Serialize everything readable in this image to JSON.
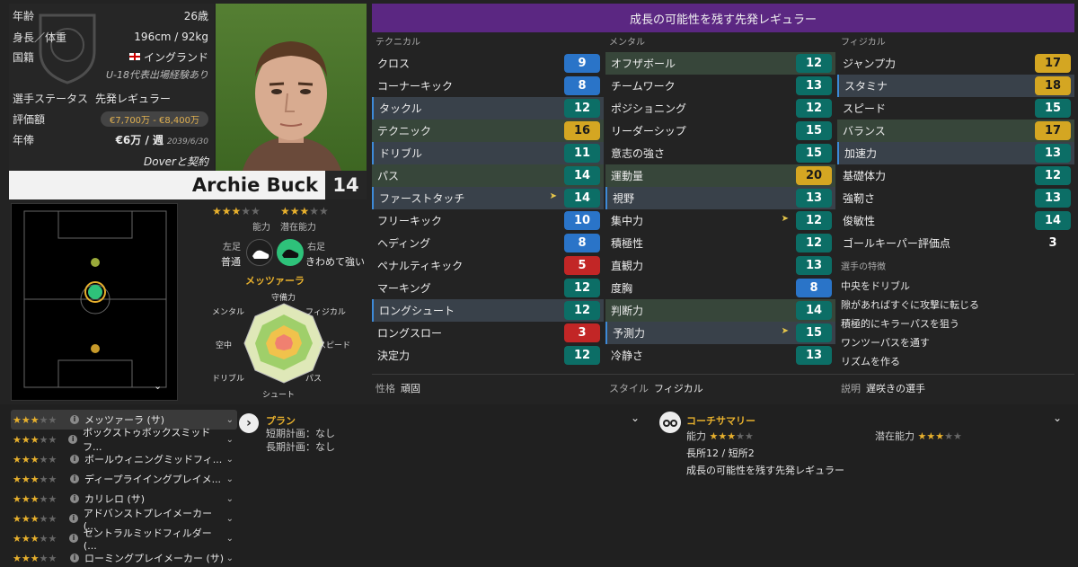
{
  "header": {
    "title": "成長の可能性を残す先発レギュラー"
  },
  "info": {
    "age_label": "年齢",
    "age": "26歳",
    "hw_label": "身長／体重",
    "hw": "196cm / 92kg",
    "nat_label": "国籍",
    "nat": "イングランド",
    "nat_note": "U-18代表出場経験あり",
    "status_label": "選手ステータス",
    "status": "先発レギュラー",
    "value_label": "評価額",
    "value": "€7,700万 - €8,400万",
    "wage_label": "年俸",
    "wage": "€6万 / 週",
    "wage_until": "2039/6/30",
    "contract": "Doverと契約"
  },
  "player": {
    "name": "Archie Buck",
    "number": "14"
  },
  "rating": {
    "ability_label": "能力",
    "potential_label": "潜在能力"
  },
  "feet": {
    "left_label": "左足",
    "left_value": "普通",
    "right_label": "右足",
    "right_value": "きわめて強い"
  },
  "role_name": "メッツァーラ",
  "radar": {
    "labels": [
      "守備力",
      "フィジカル",
      "スピード",
      "パス",
      "シュート",
      "ドリブル",
      "空中",
      "メンタル"
    ]
  },
  "attributes": {
    "technical": {
      "label": "テクニカル",
      "items": [
        {
          "name": "クロス",
          "value": "9",
          "color": "blue"
        },
        {
          "name": "コーナーキック",
          "value": "8",
          "color": "blue"
        },
        {
          "name": "タックル",
          "value": "12",
          "color": "teal",
          "hl": "hl"
        },
        {
          "name": "テクニック",
          "value": "16",
          "color": "gold",
          "hl": "hlg"
        },
        {
          "name": "ドリブル",
          "value": "11",
          "color": "teal",
          "hl": "hl"
        },
        {
          "name": "パス",
          "value": "14",
          "color": "teal",
          "hl": "hlg"
        },
        {
          "name": "ファーストタッチ",
          "value": "14",
          "color": "teal",
          "hl": "hl",
          "arrow": true
        },
        {
          "name": "フリーキック",
          "value": "10",
          "color": "blue"
        },
        {
          "name": "ヘディング",
          "value": "8",
          "color": "blue"
        },
        {
          "name": "ペナルティキック",
          "value": "5",
          "color": "red"
        },
        {
          "name": "マーキング",
          "value": "12",
          "color": "teal"
        },
        {
          "name": "ロングシュート",
          "value": "12",
          "color": "teal",
          "hl": "hl"
        },
        {
          "name": "ロングスロー",
          "value": "3",
          "color": "red"
        },
        {
          "name": "決定力",
          "value": "12",
          "color": "teal"
        }
      ]
    },
    "mental": {
      "label": "メンタル",
      "items": [
        {
          "name": "オフザボール",
          "value": "12",
          "color": "teal",
          "hl": "hlg"
        },
        {
          "name": "チームワーク",
          "value": "13",
          "color": "teal"
        },
        {
          "name": "ポジショニング",
          "value": "12",
          "color": "teal"
        },
        {
          "name": "リーダーシップ",
          "value": "15",
          "color": "teal"
        },
        {
          "name": "意志の強さ",
          "value": "15",
          "color": "teal"
        },
        {
          "name": "運動量",
          "value": "20",
          "color": "gold",
          "hl": "hlg"
        },
        {
          "name": "視野",
          "value": "13",
          "color": "teal",
          "hl": "hl"
        },
        {
          "name": "集中力",
          "value": "12",
          "color": "teal",
          "arrow": true
        },
        {
          "name": "積極性",
          "value": "12",
          "color": "teal"
        },
        {
          "name": "直観力",
          "value": "13",
          "color": "teal"
        },
        {
          "name": "度胸",
          "value": "8",
          "color": "blue"
        },
        {
          "name": "判断力",
          "value": "14",
          "color": "teal",
          "hl": "hlg"
        },
        {
          "name": "予測力",
          "value": "15",
          "color": "teal",
          "hl": "hl",
          "arrow": true
        },
        {
          "name": "冷静さ",
          "value": "13",
          "color": "teal"
        }
      ]
    },
    "physical": {
      "label": "フィジカル",
      "items": [
        {
          "name": "ジャンプ力",
          "value": "17",
          "color": "gold"
        },
        {
          "name": "スタミナ",
          "value": "18",
          "color": "gold",
          "hl": "hl"
        },
        {
          "name": "スピード",
          "value": "15",
          "color": "teal"
        },
        {
          "name": "バランス",
          "value": "17",
          "color": "gold",
          "hl": "hlg"
        },
        {
          "name": "加速力",
          "value": "13",
          "color": "teal",
          "hl": "hl"
        },
        {
          "name": "基礎体力",
          "value": "12",
          "color": "teal"
        },
        {
          "name": "強靭さ",
          "value": "13",
          "color": "teal"
        },
        {
          "name": "俊敏性",
          "value": "14",
          "color": "teal"
        },
        {
          "name": "ゴールキーパー評価点",
          "value": "3",
          "color": "plain"
        }
      ]
    },
    "traits_label": "選手の特徴",
    "traits": [
      "中央をドリブル",
      "隙があればすぐに攻撃に転じる",
      "積極的にキラーパスを狙う",
      "ワンツーパスを通す",
      "リズムを作る"
    ]
  },
  "footer": {
    "personality_label": "性格",
    "personality": "頑固",
    "style_label": "スタイル",
    "style": "フィジカル",
    "desc_label": "説明",
    "desc": "遅咲きの選手"
  },
  "roles": [
    {
      "name": "メッツァーラ (サ)",
      "stars": 3,
      "selected": true
    },
    {
      "name": "ボックストゥボックスミッドフ...",
      "stars": 3
    },
    {
      "name": "ボールウィニングミッドフィ...",
      "stars": 3
    },
    {
      "name": "ディープライイングプレイメ...",
      "stars": 3
    },
    {
      "name": "カリレロ (サ)",
      "stars": 3
    },
    {
      "name": "アドバンストプレイメーカー (...",
      "stars": 3
    },
    {
      "name": "セントラルミッドフィルダー (...",
      "stars": 3
    },
    {
      "name": "ローミングプレイメーカー (サ)",
      "stars": 3
    }
  ],
  "plan": {
    "title": "プラン",
    "short_label": "短期計画：",
    "short": "なし",
    "long_label": "長期計画：",
    "long": "なし"
  },
  "coach": {
    "title": "コーチサマリー",
    "ability_label": "能力",
    "potential_label": "潜在能力",
    "strengths": "長所12 / 短所2",
    "summary": "成長の可能性を残す先発レギュラー"
  },
  "colors": {
    "header": "#5b2782",
    "teal": "#0c6e66",
    "blue": "#2a74c8",
    "gold": "#d4a622",
    "red": "#c22626",
    "accent": "#e7b02d"
  }
}
